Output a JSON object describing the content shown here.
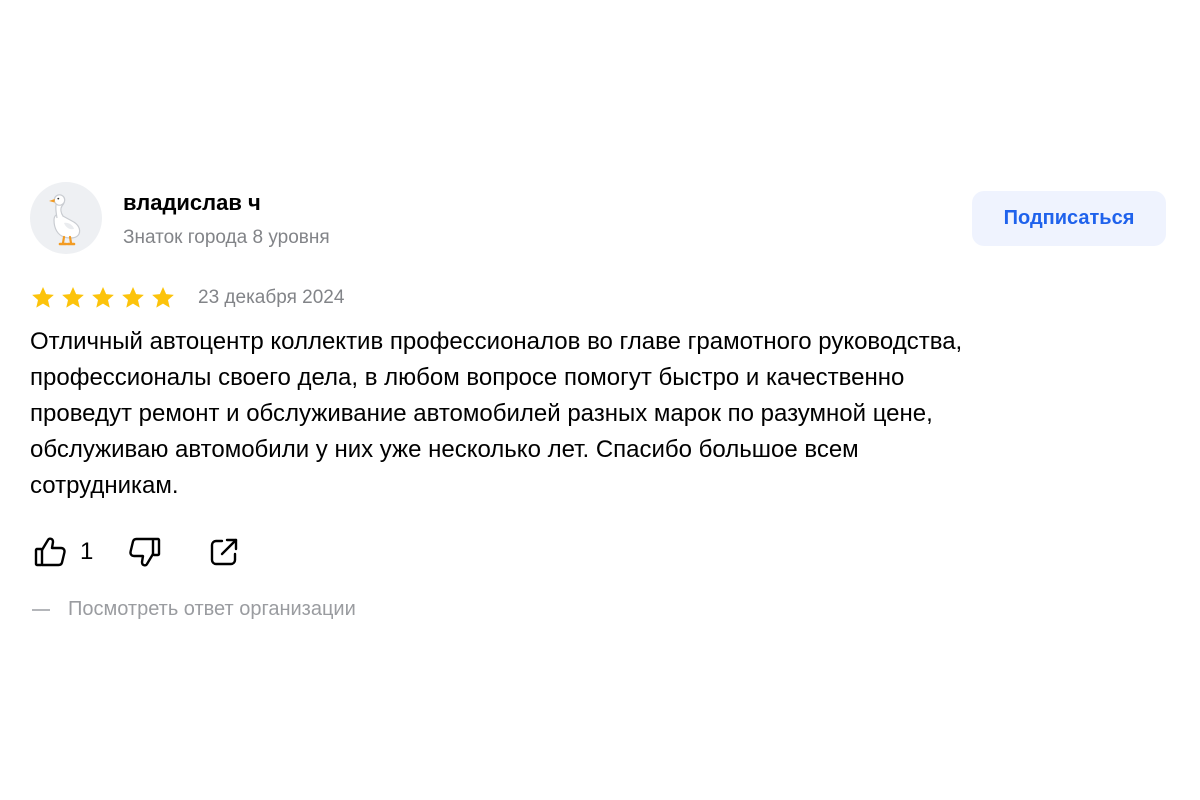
{
  "review": {
    "author": {
      "name": "владислав ч",
      "level": "Знаток города 8 уровня",
      "avatar_icon": "goose-icon"
    },
    "subscribe_label": "Подписаться",
    "rating": 5,
    "rating_max": 5,
    "date": "23 декабря 2024",
    "text_lines": [
      "Отличный автоцентр коллектив профессионалов во главе грамотного руководства,",
      "профессионалы своего дела, в любом вопросе помогут быстро и качественно",
      "проведут ремонт и обслуживание автомобилей разных марок по разумной цене,",
      "обслуживаю автомобили у них уже несколько лет. Спасибо большое всем",
      "сотрудникам."
    ],
    "likes": "1",
    "icons": {
      "like": "thumbs-up-icon",
      "dislike": "thumbs-down-icon",
      "share": "share-icon",
      "star": "star-icon"
    },
    "view_answer_label": "Посмотреть ответ организации"
  },
  "colors": {
    "star": "#fcc30b",
    "accent": "#1f62ec",
    "secondary_text": "#828488",
    "button_bg": "#eff3fe"
  }
}
